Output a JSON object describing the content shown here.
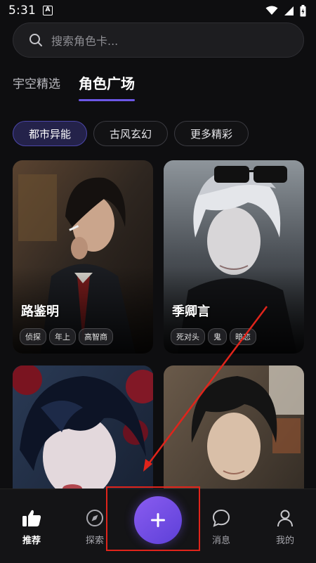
{
  "status_bar": {
    "time": "5:31",
    "app_badge": "A"
  },
  "search": {
    "placeholder": "搜索角色卡..."
  },
  "top_tabs": [
    {
      "label": "宇空精选",
      "active": false
    },
    {
      "label": "角色广场",
      "active": true
    }
  ],
  "categories": [
    {
      "label": "都市异能",
      "active": true
    },
    {
      "label": "古风玄幻",
      "active": false
    },
    {
      "label": "更多精彩",
      "active": false
    }
  ],
  "cards": [
    {
      "name": "路鉴明",
      "tags": [
        "侦探",
        "年上",
        "高智商"
      ]
    },
    {
      "name": "季卿言",
      "tags": [
        "死对头",
        "鬼",
        "暗恋"
      ]
    },
    {
      "name": "",
      "tags": []
    },
    {
      "name": "",
      "tags": []
    }
  ],
  "bottom_nav": {
    "recommend": "推荐",
    "explore": "探索",
    "messages": "消息",
    "mine": "我的"
  },
  "colors": {
    "accent": "#6c57e6",
    "fab": "#7b52ea",
    "annotation": "#e0241b"
  }
}
